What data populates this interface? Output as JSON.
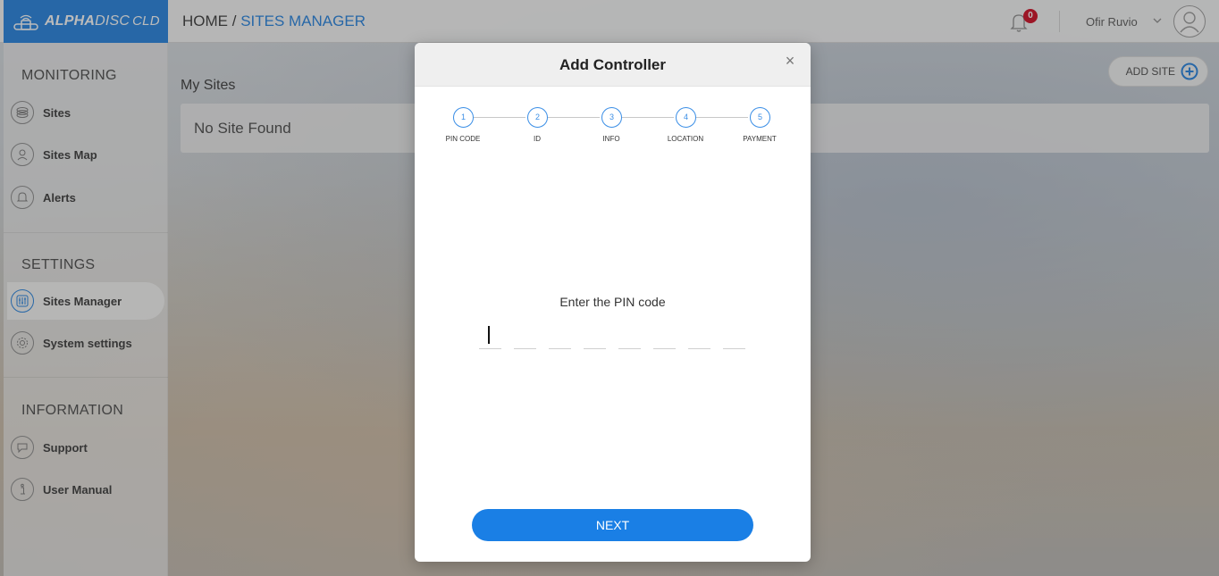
{
  "app": {
    "logo_bold": "ALPHA",
    "logo_mid": "DISC",
    "logo_suffix": "CLD"
  },
  "breadcrumb": {
    "home": "HOME /",
    "current": "SITES MANAGER"
  },
  "header": {
    "notification_count": "0",
    "user_name": "Ofir Ruvio"
  },
  "sidebar": {
    "sections": [
      {
        "title": "MONITORING",
        "items": [
          {
            "label": "Sites",
            "icon": "sites-icon"
          },
          {
            "label": "Sites Map",
            "icon": "map-pin-icon"
          },
          {
            "label": "Alerts",
            "icon": "bell-icon"
          }
        ]
      },
      {
        "title": "SETTINGS",
        "items": [
          {
            "label": "Sites Manager",
            "icon": "sliders-icon"
          },
          {
            "label": "System settings",
            "icon": "gear-icon"
          }
        ]
      },
      {
        "title": "INFORMATION",
        "items": [
          {
            "label": "Support",
            "icon": "chat-icon"
          },
          {
            "label": "User Manual",
            "icon": "info-icon"
          }
        ]
      }
    ]
  },
  "main": {
    "title": "My Sites",
    "empty_text": "No Site Found",
    "add_site_label": "ADD SITE"
  },
  "modal": {
    "title": "Add Controller",
    "close_symbol": "×",
    "steps": [
      {
        "number": "1",
        "label": "PIN CODE"
      },
      {
        "number": "2",
        "label": "ID"
      },
      {
        "number": "3",
        "label": "INFO"
      },
      {
        "number": "4",
        "label": "LOCATION"
      },
      {
        "number": "5",
        "label": "PAYMENT"
      }
    ],
    "prompt": "Enter the PIN code",
    "pin_length": 8,
    "next_label": "NEXT"
  },
  "colors": {
    "accent": "#1d7fe0",
    "badge": "#d0021b"
  }
}
